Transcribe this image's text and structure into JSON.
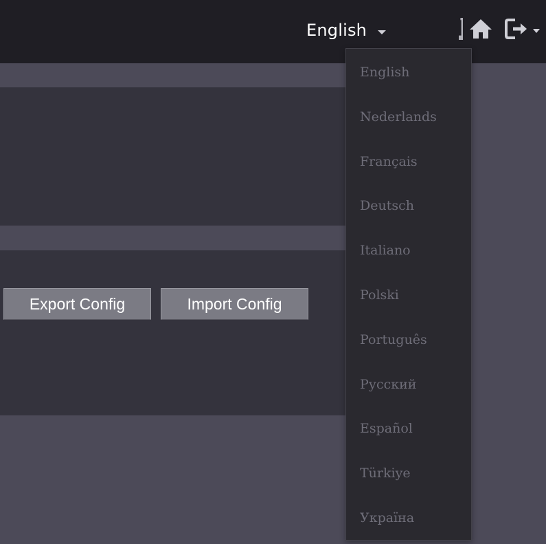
{
  "header": {
    "language_selected": "English",
    "icons": [
      "home-icon",
      "logout-icon"
    ]
  },
  "actions": {
    "export_label": "Export Config",
    "import_label": "Import Config"
  },
  "language_menu": {
    "items": [
      {
        "label": "English"
      },
      {
        "label": "Nederlands"
      },
      {
        "label": "Français"
      },
      {
        "label": "Deutsch"
      },
      {
        "label": "Italiano"
      },
      {
        "label": "Polski"
      },
      {
        "label": "Português"
      },
      {
        "label": "Русский"
      },
      {
        "label": "Español"
      },
      {
        "label": "Türkiye"
      },
      {
        "label": "Україна"
      }
    ]
  },
  "colors": {
    "topbar": "#1f1e24",
    "background": "#4c4a58",
    "panel": "#34333d",
    "button": "#7b7b84",
    "menu": "#2a292f",
    "menu_text": "#6e6d78"
  }
}
